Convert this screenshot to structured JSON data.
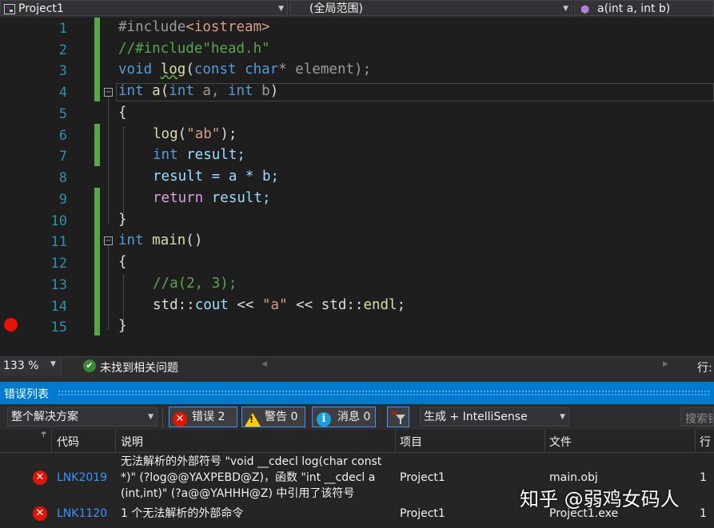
{
  "navbar": {
    "project": "Project1",
    "scope": "(全局范围)",
    "member": "a(int a, int b)"
  },
  "editor": {
    "line_numbers": [
      "1",
      "2",
      "3",
      "4",
      "5",
      "6",
      "7",
      "8",
      "9",
      "10",
      "11",
      "12",
      "13",
      "14",
      "15"
    ],
    "lines": {
      "l1_a": "#include",
      "l1_b": "<iostream>",
      "l2": "//#include\"head.h\"",
      "l3_kw": "void",
      "l3_fn": "log",
      "l3_rest1": "(",
      "l3_kw2": "const char",
      "l3_rest2": "* element);",
      "l4_kw": "int",
      "l4_fn": "a",
      "l4_rest1": "(",
      "l4_kw2": "int",
      "l4_p1": " a,",
      "l4_kw3": " int",
      "l4_p2": " b",
      "l4_rest2": ")",
      "l5": "{",
      "l6_fn": "log",
      "l6_rest1": "(",
      "l6_str": "\"ab\"",
      "l6_rest2": ");",
      "l7_kw": "int",
      "l7_rest": " result;",
      "l8": "result = a * b;",
      "l9_kw": "return",
      "l9_rest": " result;",
      "l10": "}",
      "l11_kw": "int",
      "l11_fn": " main",
      "l11_rest": "()",
      "l12": "{",
      "l13": "//a(2, 3);",
      "l14_a": "std::",
      "l14_b": "cout",
      "l14_c": " << ",
      "l14_str": "\"a\"",
      "l14_d": " << std::",
      "l14_e": "endl",
      "l14_f": ";",
      "l15": "}"
    }
  },
  "statusbar": {
    "zoom": "133 %",
    "issues": "未找到相关问题",
    "line_label": "行:"
  },
  "error_list": {
    "title": "错误列表",
    "scope_combo": "整个解决方案",
    "errors_btn": "错误 2",
    "warnings_btn": "警告 0",
    "messages_btn": "消息 0",
    "build_combo": "生成 + IntelliSense",
    "search_placeholder": "搜索错",
    "columns": {
      "code": "代码",
      "desc": "说明",
      "project": "项目",
      "file": "文件",
      "line": "行"
    },
    "rows": [
      {
        "code": "LNK2019",
        "desc1": "无法解析的外部符号 \"void __cdecl log(char const",
        "desc2": "*)\" (?log@@YAXPEBD@Z)，函数 \"int __cdecl a",
        "desc3": "(int,int)\" (?a@@YAHHH@Z) 中引用了该符号",
        "project": "Project1",
        "file": "main.obj",
        "line": "1"
      },
      {
        "code": "LNK1120",
        "desc1": "1 个无法解析的外部命令",
        "project": "Project1",
        "file": "Project1.exe",
        "line": "1"
      }
    ]
  },
  "watermark": "知乎 @弱鸡女码人",
  "colors": {
    "accent": "#007acc",
    "error": "#e51400",
    "warning": "#ffcc00",
    "info": "#1ba1e2",
    "change_bar": "#57a64a",
    "breakpoint": "#e51400"
  }
}
